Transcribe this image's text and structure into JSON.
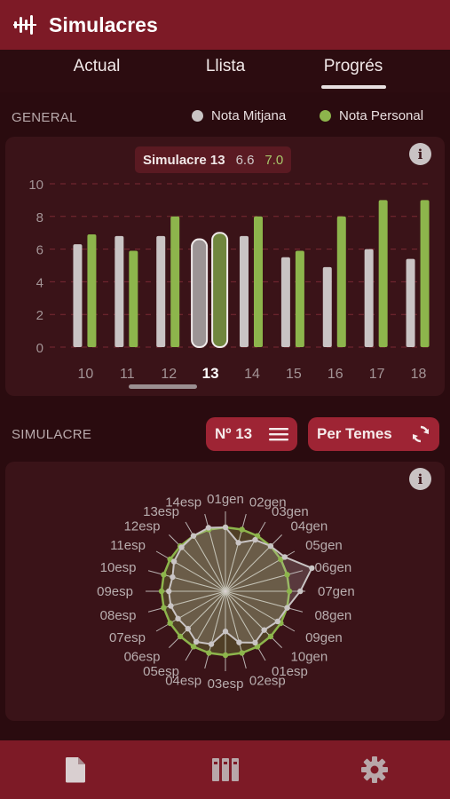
{
  "app": {
    "title": "Simulacres"
  },
  "tabs": [
    {
      "label": "Actual",
      "active": false
    },
    {
      "label": "Llista",
      "active": false
    },
    {
      "label": "Progrés",
      "active": true
    }
  ],
  "general": {
    "section_label": "GENERAL",
    "legend": [
      {
        "label": "Nota Mitjana",
        "color": "#c9c4c4"
      },
      {
        "label": "Nota Personal",
        "color": "#8db54c"
      }
    ],
    "tooltip": {
      "label": "Simulacre 13",
      "mitjana": "6.6",
      "personal": "7.0"
    }
  },
  "simulacre": {
    "section_label": "SIMULACRE",
    "number_button": "Nº 13",
    "topics_button": "Per Temes"
  },
  "colors": {
    "accent": "#7d1a26",
    "pill": "#9e2434",
    "mitjana": "#c9c4c4",
    "personal": "#8db54c"
  },
  "chart_data": [
    {
      "type": "bar",
      "categories": [
        "10",
        "11",
        "12",
        "13",
        "14",
        "15",
        "16",
        "17",
        "18"
      ],
      "selected": "13",
      "series": [
        {
          "name": "Nota Mitjana",
          "values": [
            6.3,
            6.8,
            6.8,
            6.6,
            6.8,
            5.5,
            4.9,
            6.0,
            5.4
          ]
        },
        {
          "name": "Nota Personal",
          "values": [
            6.9,
            5.9,
            8.0,
            7.0,
            8.0,
            5.9,
            8.0,
            9.0,
            9.0
          ]
        }
      ],
      "yticks": [
        "0",
        "2",
        "4",
        "6",
        "8",
        "10"
      ],
      "ylim": [
        0,
        10
      ],
      "grid": true
    },
    {
      "type": "radar",
      "categories": [
        "01gen",
        "02gen",
        "03gen",
        "04gen",
        "05gen",
        "06gen",
        "07gen",
        "08gen",
        "09gen",
        "10gen",
        "01esp",
        "02esp",
        "03esp",
        "04esp",
        "05esp",
        "06esp",
        "07esp",
        "08esp",
        "09esp",
        "10esp",
        "11esp",
        "12esp",
        "13esp",
        "14esp"
      ],
      "max": 10,
      "series": [
        {
          "name": "Nota Mitjana",
          "values": [
            7.0,
            5.5,
            6.5,
            7.0,
            7.5,
            9.8,
            8.2,
            7.0,
            6.6,
            6.0,
            6.5,
            5.8,
            4.4,
            6.0,
            6.4,
            5.8,
            6.0,
            6.2,
            6.2,
            6.0,
            6.5,
            6.8,
            7.0,
            7.2
          ]
        },
        {
          "name": "Nota Personal",
          "values": [
            7.0,
            7.0,
            7.0,
            7.0,
            7.0,
            7.0,
            7.0,
            7.0,
            7.0,
            7.0,
            7.0,
            7.0,
            7.0,
            7.0,
            7.0,
            7.0,
            7.0,
            7.0,
            7.0,
            7.0,
            7.0,
            7.0,
            7.0,
            7.0
          ]
        }
      ]
    }
  ]
}
